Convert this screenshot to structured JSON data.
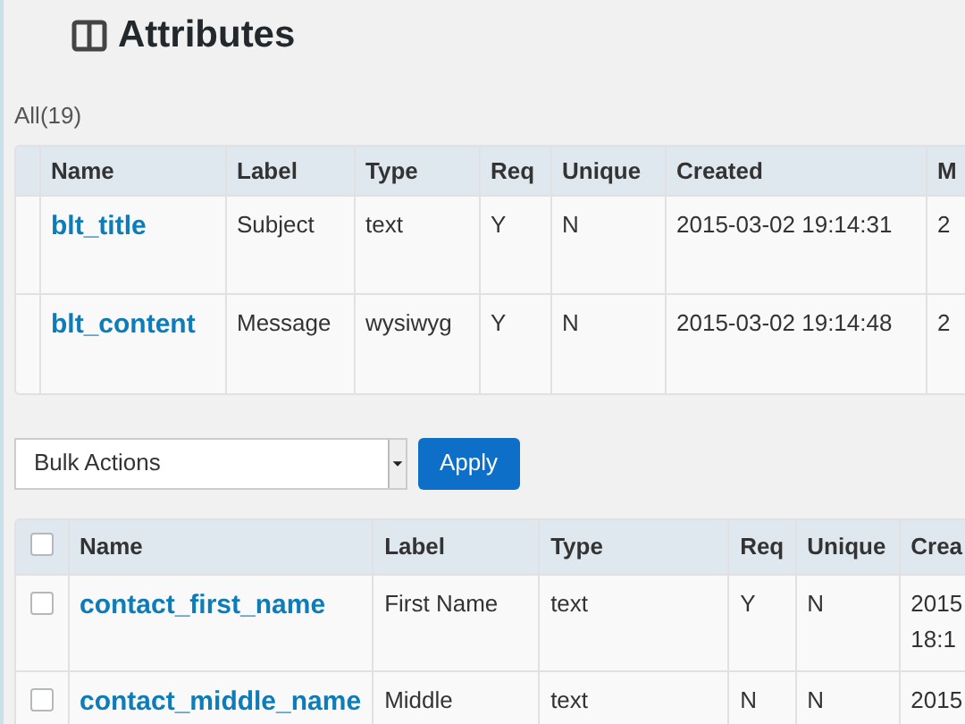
{
  "page_title": "Attributes",
  "filter": "All(19)",
  "table_1": {
    "columns": [
      "",
      "Name",
      "Label",
      "Type",
      "Req",
      "Unique",
      "Created",
      "M"
    ],
    "rows": [
      {
        "cells": [
          "",
          "blt_title",
          "Subject",
          "text",
          "Y",
          "N",
          "2015-03-02 19:14:31",
          "2"
        ]
      },
      {
        "cells": [
          "",
          "blt_content",
          "Message",
          "wysiwyg",
          "Y",
          "N",
          "2015-03-02 19:14:48",
          "2"
        ]
      }
    ]
  },
  "bulk_actions": {
    "value": "Bulk Actions",
    "button": "Apply"
  },
  "table_2": {
    "select_all_checked": false,
    "columns": [
      "Name",
      "Label",
      "Type",
      "Req",
      "Unique",
      "Crea"
    ],
    "rows": [
      {
        "checked": false,
        "cells": [
          "contact_first_name",
          "First Name",
          "text",
          "Y",
          "N",
          "2015\n18:1"
        ]
      },
      {
        "checked": false,
        "cells": [
          "contact_middle_name",
          "Middle",
          "text",
          "N",
          "N",
          "2015"
        ]
      }
    ]
  }
}
